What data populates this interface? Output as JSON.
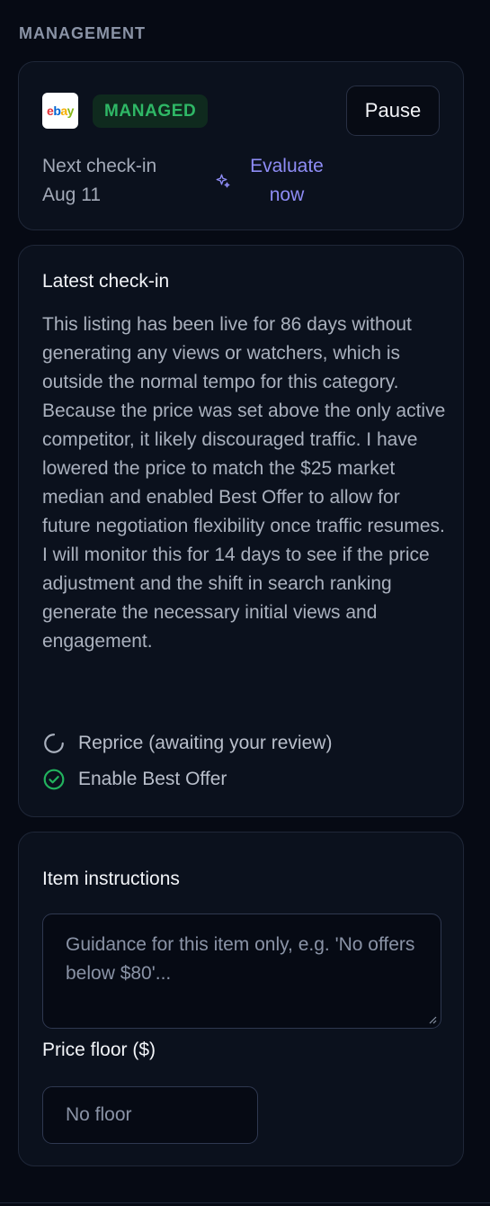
{
  "section": {
    "label": "MANAGEMENT"
  },
  "status": {
    "marketplace_icon": "ebay-logo",
    "logo_text": {
      "e": "e",
      "b": "b",
      "a": "a",
      "y": "y"
    },
    "badge": "MANAGED",
    "pause_label": "Pause",
    "next_checkin_label": "Next check-in",
    "next_checkin_date": "Aug 11",
    "evaluate_label": "Evaluate now",
    "evaluate_icon": "sparkle-icon"
  },
  "latest_checkin": {
    "title": "Latest check-in",
    "summary": "This listing has been live for 86 days without generating any views or watchers, which is outside the normal tempo for this category. Because the price was set above the only active competitor, it likely discouraged traffic. I have lowered the price to match the $25 market median and enabled Best Offer to allow for future negotiation flexibility once traffic resumes. I will monitor this for 14 days to see if the price adjustment and the shift in search ranking generate the necessary initial views and engagement.",
    "actions": [
      {
        "label": "Reprice (awaiting your review)",
        "status": "pending",
        "icon": "spinner-icon"
      },
      {
        "label": "Enable Best Offer",
        "status": "done",
        "icon": "check-circle-icon"
      }
    ]
  },
  "instructions": {
    "title": "Item instructions",
    "placeholder": "Guidance for this item only, e.g. 'No offers below $80'...",
    "value": "",
    "price_floor_label": "Price floor ($)",
    "price_floor_placeholder": "No floor",
    "price_floor_value": ""
  },
  "colors": {
    "background": "#060a14",
    "card": "#0b111d",
    "managed_green": "#2fb866",
    "accent_purple": "#8e8cf5",
    "success_green": "#22b35e"
  }
}
